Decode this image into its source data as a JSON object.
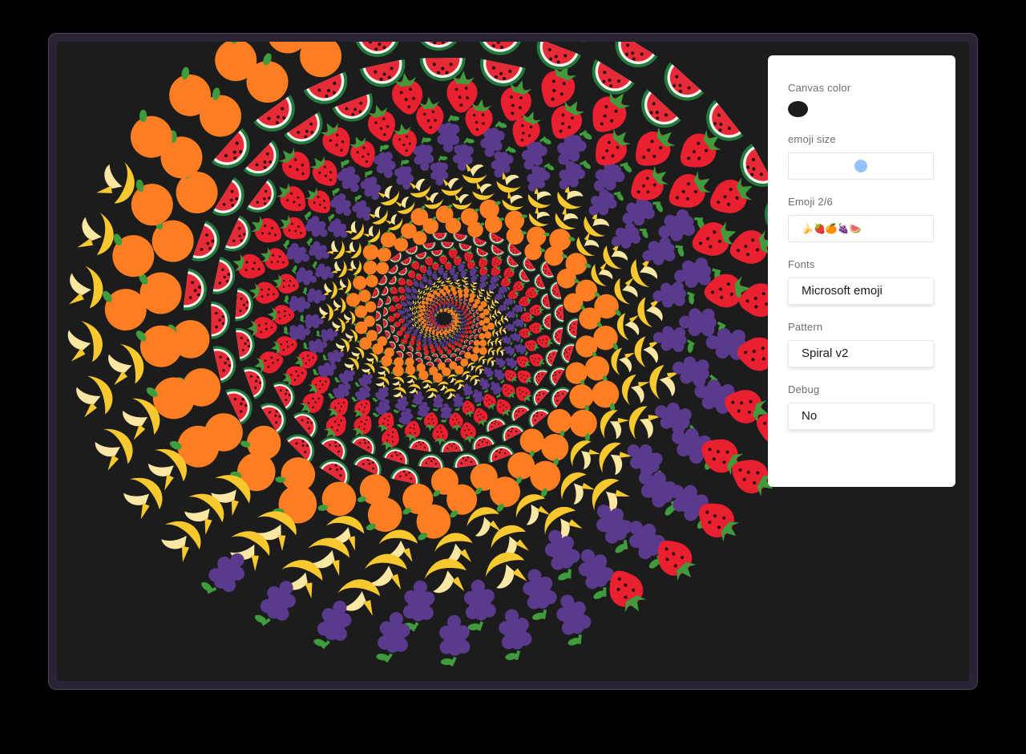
{
  "app": {
    "canvas_bg": "#1c1c1c",
    "pattern_emojis": [
      "strawberry",
      "grapes",
      "banana",
      "orange",
      "watermelon"
    ],
    "colors": {
      "strawberry": "#e8202f",
      "grapes": "#5a3a8c",
      "banana": "#f8c82e",
      "orange": "#fc7d22",
      "watermelon": "#e62a37",
      "leaf": "#3f9c3c"
    }
  },
  "panel": {
    "canvas_color": {
      "label": "Canvas color",
      "value": "#1c1c1c"
    },
    "emoji_size": {
      "label": "emoji size",
      "value": 0.5
    },
    "emoji": {
      "label": "Emoji 2/6",
      "value": "🍌🍓🍊🍇🍉"
    },
    "fonts": {
      "label": "Fonts",
      "value": "Microsoft emoji"
    },
    "pattern": {
      "label": "Pattern",
      "value": "Spiral v2"
    },
    "debug": {
      "label": "Debug",
      "value": "No"
    }
  }
}
